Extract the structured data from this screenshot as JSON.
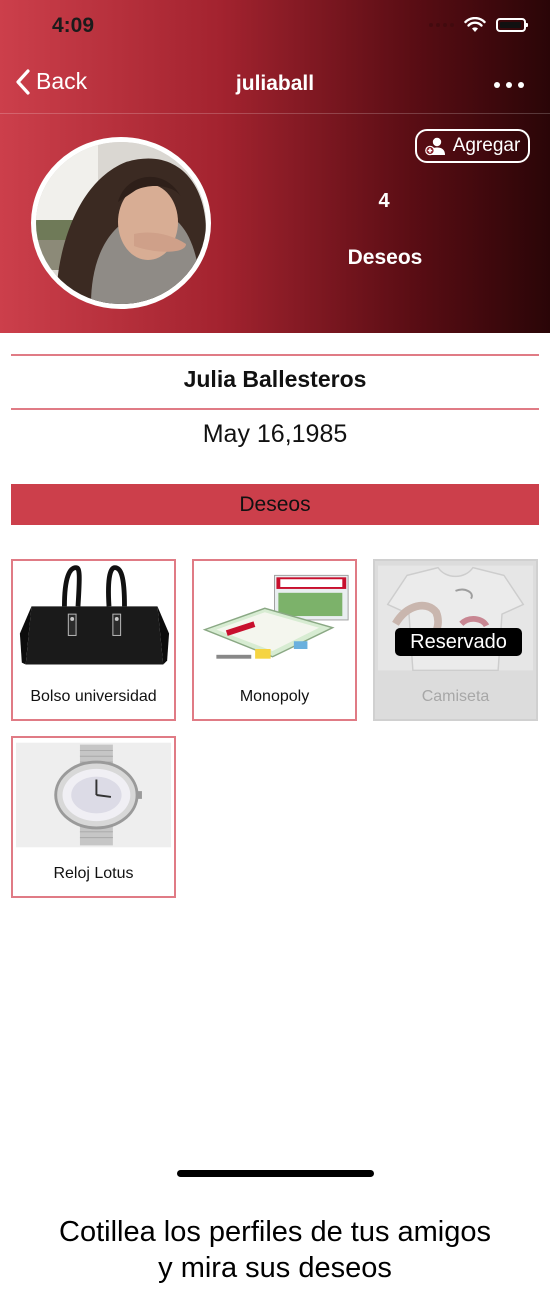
{
  "status_bar": {
    "time": "4:09"
  },
  "nav": {
    "back_label": "Back",
    "title": "juliaball"
  },
  "profile": {
    "add_button_label": "Agregar",
    "wish_count": "4",
    "wish_count_label": "Deseos",
    "full_name": "Julia Ballesteros",
    "birthdate": "May 16,1985"
  },
  "wishes_section": {
    "title": "Deseos",
    "items": [
      {
        "name": "Bolso universidad",
        "reserved": false
      },
      {
        "name": "Monopoly",
        "reserved": false
      },
      {
        "name": "Camiseta",
        "reserved": true,
        "badge": "Reservado"
      },
      {
        "name": "Reloj Lotus",
        "reserved": false
      }
    ]
  },
  "promo_text": {
    "line1": "Cotillea los perfiles de tus amigos",
    "line2": "y mira sus deseos"
  },
  "colors": {
    "accent": "#cc3f4b",
    "header_dark": "#2a0507",
    "card_border": "#e07b85"
  }
}
